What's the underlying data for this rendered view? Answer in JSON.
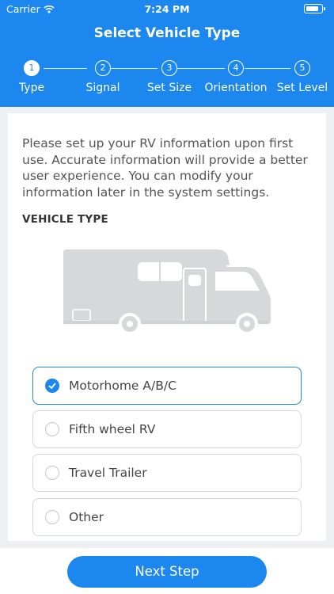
{
  "status_bar": {
    "carrier": "Carrier",
    "time": "7:24 PM"
  },
  "header": {
    "title": "Select Vehicle Type"
  },
  "steps": [
    {
      "number": "1",
      "label": "Type",
      "active": true
    },
    {
      "number": "2",
      "label": "Signal",
      "active": false
    },
    {
      "number": "3",
      "label": "Set Size",
      "active": false
    },
    {
      "number": "4",
      "label": "Orientation",
      "active": false
    },
    {
      "number": "5",
      "label": "Set Level",
      "active": false
    }
  ],
  "content": {
    "intro_text": "Please set up your RV information upon first use. Accurate information will provide a better user experience. You can modify your information later in the system settings.",
    "section_title": "VEHICLE TYPE",
    "illustration_icon": "rv-motorhome-icon"
  },
  "options": [
    {
      "label": "Motorhome A/B/C",
      "selected": true
    },
    {
      "label": "Fifth wheel RV",
      "selected": false
    },
    {
      "label": "Travel Trailer",
      "selected": false
    },
    {
      "label": "Other",
      "selected": false
    }
  ],
  "footer": {
    "next_label": "Next Step"
  },
  "colors": {
    "primary": "#1b87ef",
    "background": "#eef0f3"
  }
}
